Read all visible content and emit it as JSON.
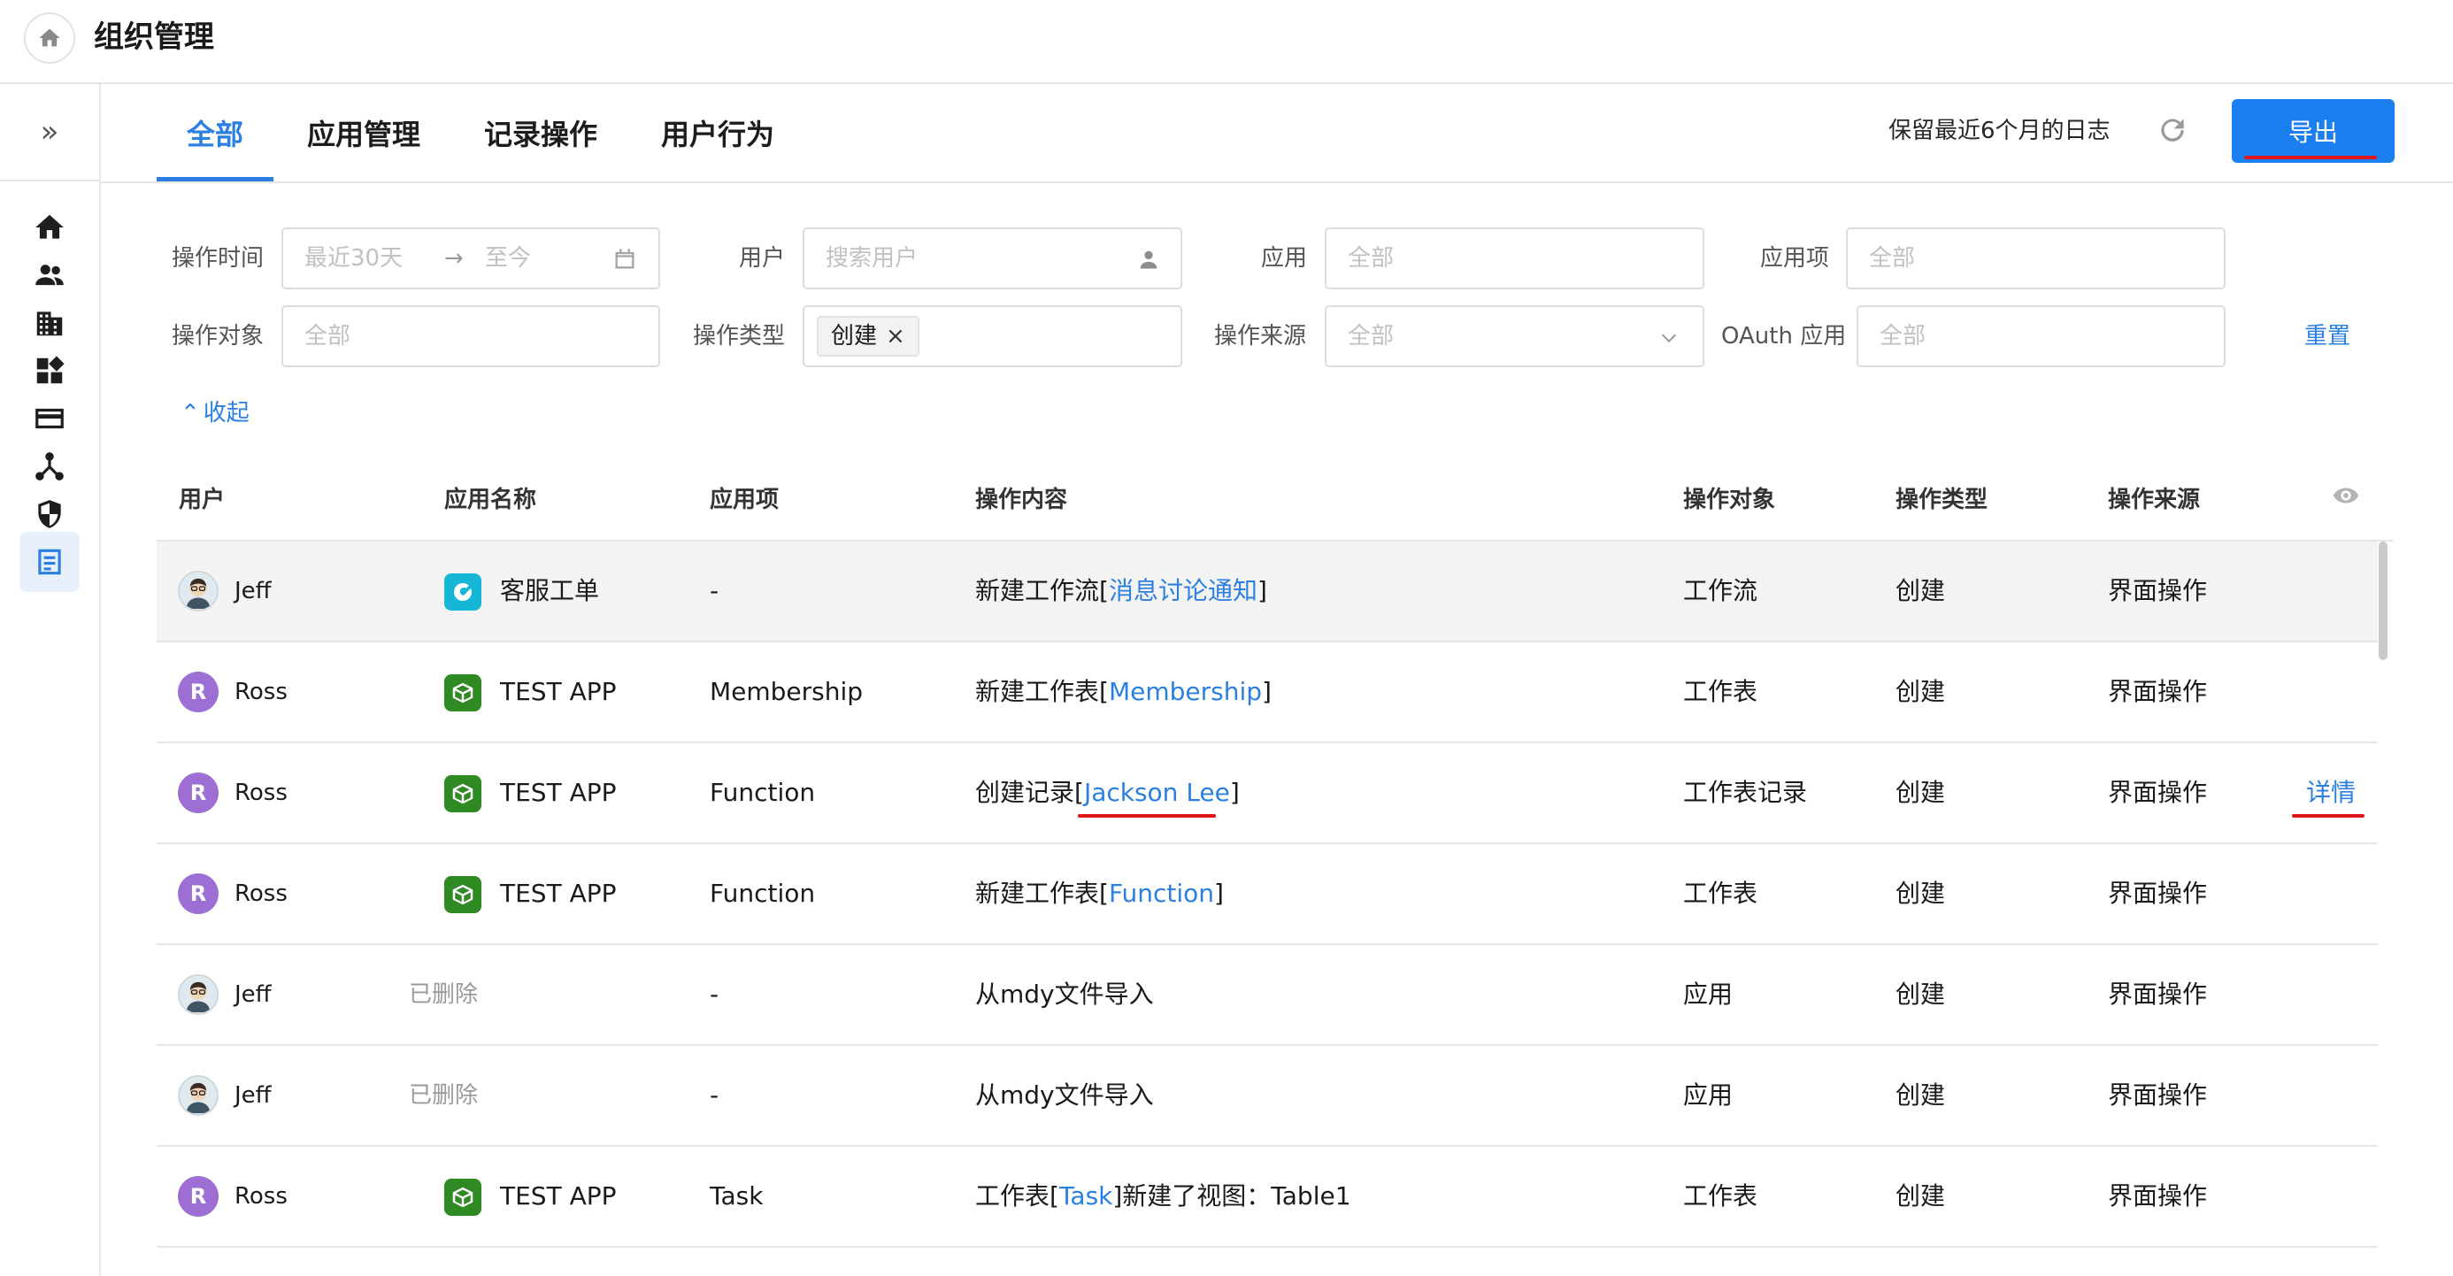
{
  "header": {
    "title": "组织管理"
  },
  "tabs": [
    {
      "label": "全部",
      "active": true
    },
    {
      "label": "应用管理",
      "active": false
    },
    {
      "label": "记录操作",
      "active": false
    },
    {
      "label": "用户行为",
      "active": false
    }
  ],
  "toolbar": {
    "retention": "保留最近6个月的日志",
    "export_label": "导出"
  },
  "filters": {
    "time_label": "操作时间",
    "time_start": "最近30天",
    "time_sep": "→",
    "time_end": "至今",
    "user_label": "用户",
    "user_placeholder": "搜索用户",
    "app_label": "应用",
    "app_placeholder": "全部",
    "app_item_label": "应用项",
    "app_item_placeholder": "全部",
    "object_label": "操作对象",
    "object_placeholder": "全部",
    "type_label": "操作类型",
    "type_chip": "创建",
    "type_chip_remove": "×",
    "source_label": "操作来源",
    "source_placeholder": "全部",
    "oauth_label": "OAuth 应用",
    "oauth_placeholder": "全部",
    "reset": "重置",
    "collapse": "收起"
  },
  "table": {
    "columns": [
      "用户",
      "应用名称",
      "应用项",
      "操作内容",
      "操作对象",
      "操作类型",
      "操作来源"
    ],
    "detail_label": "详情",
    "rows": [
      {
        "user": "Jeff",
        "avatar_letter": "",
        "app": "客服工单",
        "item": "-",
        "content_pre": "新建工作流[",
        "content_link": "消息讨论通知",
        "content_post": "]",
        "object": "工作流",
        "type": "创建",
        "source": "界面操作"
      },
      {
        "user": "Ross",
        "avatar_letter": "R",
        "app": "TEST APP",
        "item": "Membership",
        "content_pre": "新建工作表[",
        "content_link": "Membership",
        "content_post": "]",
        "object": "工作表",
        "type": "创建",
        "source": "界面操作"
      },
      {
        "user": "Ross",
        "avatar_letter": "R",
        "app": "TEST APP",
        "item": "Function",
        "content_pre": "创建记录[",
        "content_link": "Jackson Lee",
        "content_post": "]",
        "object": "工作表记录",
        "type": "创建",
        "source": "界面操作"
      },
      {
        "user": "Ross",
        "avatar_letter": "R",
        "app": "TEST APP",
        "item": "Function",
        "content_pre": "新建工作表[",
        "content_link": "Function",
        "content_post": "]",
        "object": "工作表",
        "type": "创建",
        "source": "界面操作"
      },
      {
        "user": "Jeff",
        "avatar_letter": "",
        "app": "已删除",
        "item": "-",
        "content_pre": "从mdy文件导入",
        "content_link": "",
        "content_post": "",
        "object": "应用",
        "type": "创建",
        "source": "界面操作"
      },
      {
        "user": "Jeff",
        "avatar_letter": "",
        "app": "已删除",
        "item": "-",
        "content_pre": "从mdy文件导入",
        "content_link": "",
        "content_post": "",
        "object": "应用",
        "type": "创建",
        "source": "界面操作"
      },
      {
        "user": "Ross",
        "avatar_letter": "R",
        "app": "TEST APP",
        "item": "Task",
        "content_pre": "工作表[",
        "content_link": "Task",
        "content_post": "]新建了视图：Table1",
        "object": "工作表",
        "type": "创建",
        "source": "界面操作"
      }
    ]
  },
  "colors": {
    "accent": "#2a7fe0",
    "button": "#1c7ff0",
    "annotation_red": "#e0141b",
    "avatar_purple": "#9d6fd4",
    "app_teal": "#16b7d6",
    "app_green": "#2f8a24"
  }
}
